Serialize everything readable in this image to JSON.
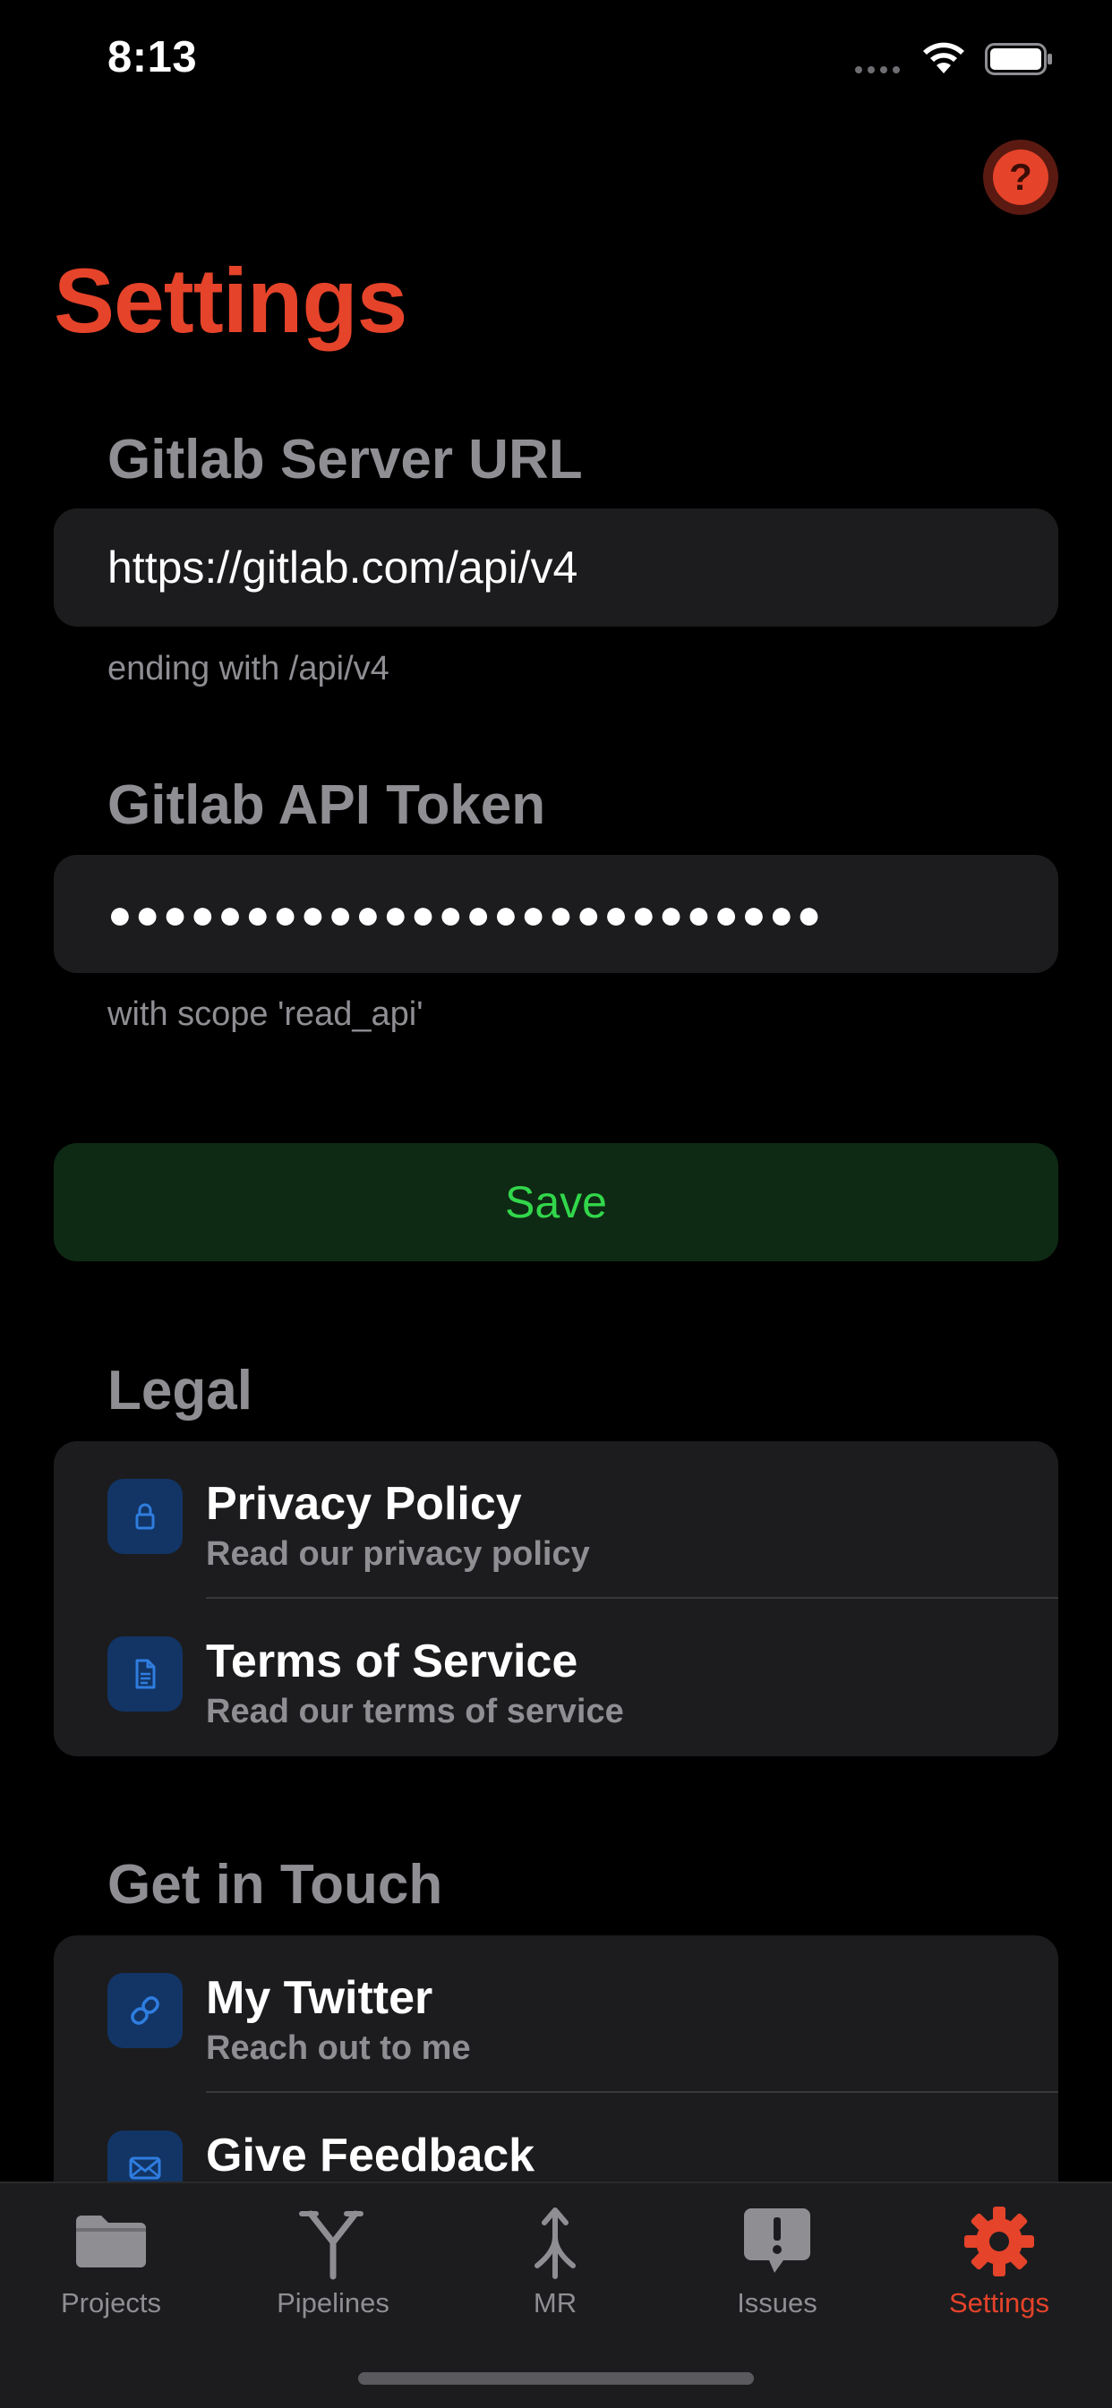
{
  "status_bar": {
    "time": "8:13"
  },
  "header": {
    "title": "Settings",
    "help_label": "?"
  },
  "server": {
    "label": "Gitlab Server URL",
    "value": "https://gitlab.com/api/v4",
    "hint": "ending with /api/v4"
  },
  "token": {
    "label": "Gitlab API Token",
    "masked_value": "●●●●●●●●●●●●●●●●●●●●●●●●●●",
    "hint": "with scope 'read_api'"
  },
  "save_label": "Save",
  "legal": {
    "label": "Legal",
    "items": [
      {
        "title": "Privacy Policy",
        "subtitle": "Read our privacy policy",
        "icon": "lock-icon"
      },
      {
        "title": "Terms of Service",
        "subtitle": "Read our terms of service",
        "icon": "document-icon"
      }
    ]
  },
  "contact": {
    "label": "Get in Touch",
    "items": [
      {
        "title": "My Twitter",
        "subtitle": "Reach out to me",
        "icon": "link-icon"
      },
      {
        "title": "Give Feedback",
        "subtitle": "",
        "icon": "envelope-icon"
      }
    ]
  },
  "tabs": [
    {
      "label": "Projects",
      "icon": "folder-icon"
    },
    {
      "label": "Pipelines",
      "icon": "pipeline-icon"
    },
    {
      "label": "MR",
      "icon": "merge-icon"
    },
    {
      "label": "Issues",
      "icon": "issue-icon"
    },
    {
      "label": "Settings",
      "icon": "gear-icon",
      "active": true
    }
  ],
  "colors": {
    "accent": "#e5432a",
    "save_text": "#32d74b",
    "save_bg": "#0f2a14",
    "icon_bg": "#123566",
    "icon_fg": "#2f7ddf"
  }
}
